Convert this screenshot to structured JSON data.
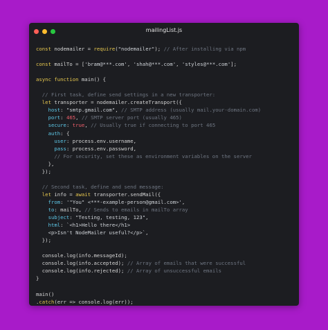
{
  "window": {
    "title": "mailingList.js",
    "controls": [
      "close",
      "minimize",
      "maximize"
    ]
  },
  "colors": {
    "background": "#a81bc9",
    "editor": "#1c1d21",
    "keyword": "#e7c84f",
    "comment": "#6f7682",
    "number": "#ef5f6b",
    "property": "#5ec8e8",
    "plain": "#d6d6d6"
  },
  "code_lines": [
    [
      [
        "kw",
        "const "
      ],
      [
        "pl",
        "nodemailer = "
      ],
      [
        "kw",
        "require"
      ],
      [
        "pl",
        "("
      ],
      [
        "str",
        "\"nodemailer\""
      ],
      [
        "pl",
        ");"
      ],
      [
        "cmt",
        " // After installing via npm"
      ]
    ],
    [],
    [
      [
        "kw",
        "const "
      ],
      [
        "pl",
        "mailTo = ["
      ],
      [
        "str",
        "'bram@***.com'"
      ],
      [
        "pl",
        ", "
      ],
      [
        "str",
        "'shah@***.com'"
      ],
      [
        "pl",
        ", "
      ],
      [
        "str",
        "'styles@***.com'"
      ],
      [
        "pl",
        "];"
      ]
    ],
    [],
    [
      [
        "kw",
        "async function "
      ],
      [
        "fn",
        "main"
      ],
      [
        "pl",
        "() {"
      ]
    ],
    [],
    [
      [
        "cmt",
        "  // First task, define send settings in a new transporter:"
      ]
    ],
    [
      [
        "kw",
        "  let "
      ],
      [
        "pl",
        "transporter = nodemailer."
      ],
      [
        "fn",
        "createTransport"
      ],
      [
        "pl",
        "({"
      ]
    ],
    [
      [
        "prop",
        "    host"
      ],
      [
        "pl",
        ": "
      ],
      [
        "str",
        "\"smtp.gmail.com\""
      ],
      [
        "pl",
        ","
      ],
      [
        "cmt",
        " // SMTP address (usually mail.your-domain.com)"
      ]
    ],
    [
      [
        "prop",
        "    port"
      ],
      [
        "pl",
        ": "
      ],
      [
        "num",
        "465"
      ],
      [
        "pl",
        ","
      ],
      [
        "cmt",
        " // SMTP server port (usually 465)"
      ]
    ],
    [
      [
        "prop",
        "    secure"
      ],
      [
        "pl",
        ": "
      ],
      [
        "num",
        "true"
      ],
      [
        "pl",
        ","
      ],
      [
        "cmt",
        " // Usually true if connecting to port 465"
      ]
    ],
    [
      [
        "prop",
        "    auth"
      ],
      [
        "pl",
        ": {"
      ]
    ],
    [
      [
        "prop",
        "      user"
      ],
      [
        "pl",
        ": process.env.username,"
      ]
    ],
    [
      [
        "prop",
        "      pass"
      ],
      [
        "pl",
        ": process.env.password,"
      ]
    ],
    [
      [
        "cmt",
        "      // For security, set these as environment variables on the server"
      ]
    ],
    [
      [
        "pl",
        "    },"
      ]
    ],
    [
      [
        "pl",
        "  });"
      ]
    ],
    [],
    [
      [
        "cmt",
        "  // Second task, define and send message:"
      ]
    ],
    [
      [
        "kw",
        "  let "
      ],
      [
        "pl",
        "info = "
      ],
      [
        "kw",
        "await "
      ],
      [
        "pl",
        "transporter."
      ],
      [
        "fn",
        "sendMail"
      ],
      [
        "pl",
        "({"
      ]
    ],
    [
      [
        "prop",
        "    from"
      ],
      [
        "pl",
        ": "
      ],
      [
        "str",
        "'\"You\" <***-example-person@gmail.com>'"
      ],
      [
        "pl",
        ","
      ]
    ],
    [
      [
        "prop",
        "    to"
      ],
      [
        "pl",
        ": mailTo,"
      ],
      [
        "cmt",
        " // Sends to emails in mailTo array"
      ]
    ],
    [
      [
        "prop",
        "    subject"
      ],
      [
        "pl",
        ": "
      ],
      [
        "str",
        "\"Testing, testing, 123\""
      ],
      [
        "pl",
        ","
      ]
    ],
    [
      [
        "prop",
        "    html"
      ],
      [
        "pl",
        ": "
      ],
      [
        "str",
        "`<h1>Hello there</h1>"
      ]
    ],
    [
      [
        "str",
        "    <p>Isn't NodeMailer useful?</p>`"
      ],
      [
        "pl",
        ","
      ]
    ],
    [
      [
        "pl",
        "  });"
      ]
    ],
    [],
    [
      [
        "pl",
        "  console."
      ],
      [
        "fn",
        "log"
      ],
      [
        "pl",
        "(info.messageId);"
      ]
    ],
    [
      [
        "pl",
        "  console."
      ],
      [
        "fn",
        "log"
      ],
      [
        "pl",
        "(info.accepted);"
      ],
      [
        "cmt",
        " // Array of emails that were successful"
      ]
    ],
    [
      [
        "pl",
        "  console."
      ],
      [
        "fn",
        "log"
      ],
      [
        "pl",
        "(info.rejected);"
      ],
      [
        "cmt",
        " // Array of unsuccessful emails"
      ]
    ],
    [
      [
        "pl",
        "}"
      ]
    ],
    [],
    [
      [
        "fn",
        "main"
      ],
      [
        "pl",
        "()"
      ]
    ],
    [
      [
        "pl",
        "."
      ],
      [
        "kw",
        "catch"
      ],
      [
        "pl",
        "(err => console."
      ],
      [
        "fn",
        "log"
      ],
      [
        "pl",
        "(err));"
      ]
    ]
  ]
}
